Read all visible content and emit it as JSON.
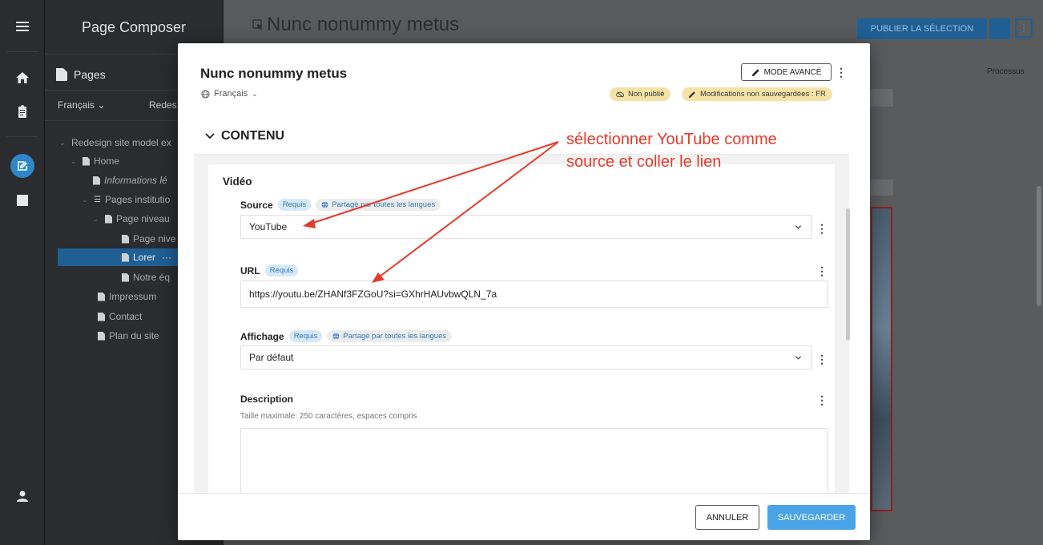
{
  "app": {
    "panel_title": "Page Composer",
    "pages_label": "Pages",
    "language_selector": "Français ⌄",
    "site_selector": "Redes",
    "page_heading": "Nunc nonummy metus",
    "publish_label": "PUBLIER LA SÉLECTION",
    "processus_label": "Processus"
  },
  "tree": [
    {
      "label": "Redesign site model ex",
      "has_chevron": true,
      "icon": "none"
    },
    {
      "label": "Home",
      "has_chevron": true,
      "icon": "doc"
    },
    {
      "label": "Informations lé",
      "has_chevron": false,
      "icon": "doc",
      "italic": true
    },
    {
      "label": "Pages institutio",
      "has_chevron": true,
      "icon": "list"
    },
    {
      "label": "Page niveau",
      "has_chevron": true,
      "icon": "doc"
    },
    {
      "label": "Page nive",
      "has_chevron": false,
      "icon": "doc"
    },
    {
      "label": "Lorer",
      "has_chevron": false,
      "icon": "doc",
      "selected": true
    },
    {
      "label": "Notre éq",
      "has_chevron": false,
      "icon": "doc"
    },
    {
      "label": "Impressum",
      "has_chevron": false,
      "icon": "doc"
    },
    {
      "label": "Contact",
      "has_chevron": false,
      "icon": "doc"
    },
    {
      "label": "Plan du site",
      "has_chevron": false,
      "icon": "doc"
    }
  ],
  "modal": {
    "title": "Nunc nonummy metus",
    "language": "Français",
    "advanced_mode": "MODE AVANCÉ",
    "status_unpublished": "Non publié",
    "status_unsaved": "Modifications non sauvegardées : FR",
    "section_title": "CONTENU",
    "card_title": "Vidéo",
    "fields": {
      "source": {
        "label": "Source",
        "required": "Requis",
        "shared": "Partagé par toutes les langues",
        "value": "YouTube"
      },
      "url": {
        "label": "URL",
        "required": "Requis",
        "value": "https://youtu.be/ZHANf3FZGoU?si=GXhrHAUvbwQLN_7a"
      },
      "display": {
        "label": "Affichage",
        "required": "Requis",
        "shared": "Partagé par toutes les langues",
        "value": "Par défaut"
      },
      "description": {
        "label": "Description",
        "helper": "Taille maximale: 250 caractères, espaces compris",
        "value": ""
      }
    },
    "cancel": "ANNULER",
    "save": "SAUVEGARDER"
  },
  "annotation": {
    "line1": "sélectionner YouTube comme",
    "line2": "source et coller le lien",
    "color": "#e53b2c"
  },
  "colors": {
    "accent": "#1f5f94",
    "save_button": "#4aa3e6",
    "pill_blue_bg": "#d7e9f7",
    "status_yellow": "#f5e3a6"
  }
}
